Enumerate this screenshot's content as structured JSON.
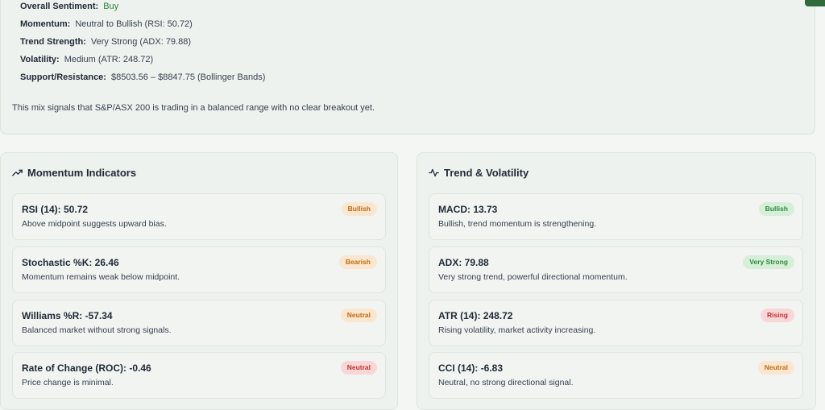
{
  "summary": {
    "rows": [
      {
        "label": "Overall Sentiment:",
        "value": "Buy"
      },
      {
        "label": "Momentum:",
        "value": "Neutral to Bullish (RSI: 50.72)"
      },
      {
        "label": "Trend Strength:",
        "value": "Very Strong (ADX: 79.88)"
      },
      {
        "label": "Volatility:",
        "value": "Medium (ATR: 248.72)"
      },
      {
        "label": "Support/Resistance:",
        "value": "$8503.56 – $8847.75 (Bollinger Bands)"
      }
    ],
    "mix_text": "This mix signals that S&P/ASX 200 is trading in a balanced range with no clear breakout yet."
  },
  "momentum": {
    "title": "Momentum Indicators",
    "icon": "trending-up-icon",
    "items": [
      {
        "name": "RSI (14): 50.72",
        "desc": "Above midpoint suggests upward bias.",
        "badge": "Bullish",
        "badge_color": "#c26a12"
      },
      {
        "name": "Stochastic %K: 26.46",
        "desc": "Momentum remains weak below midpoint.",
        "badge": "Bearish",
        "badge_color": "#c26a12"
      },
      {
        "name": "Williams %R: -57.34",
        "desc": "Balanced market without strong signals.",
        "badge": "Neutral",
        "badge_color": "#c26a12"
      },
      {
        "name": "Rate of Change (ROC): -0.46",
        "desc": "Price change is minimal.",
        "badge": "Neutral",
        "badge_color": "#c53030"
      }
    ]
  },
  "trend": {
    "title": "Trend & Volatility",
    "icon": "activity-pulse-icon",
    "items": [
      {
        "name": "MACD: 13.73",
        "desc": "Bullish, trend momentum is strengthening.",
        "badge": "Bullish",
        "badge_color": "#2f8a3e"
      },
      {
        "name": "ADX: 79.88",
        "desc": "Very strong trend, powerful directional momentum.",
        "badge": "Very Strong",
        "badge_color": "#2f8a3e"
      },
      {
        "name": "ATR (14): 248.72",
        "desc": "Rising volatility, market activity increasing.",
        "badge": "Rising",
        "badge_color": "#c53030"
      },
      {
        "name": "CCI (14): -6.83",
        "desc": "Neutral, no strong directional signal.",
        "badge": "Neutral",
        "badge_color": "#c26a12"
      }
    ]
  }
}
